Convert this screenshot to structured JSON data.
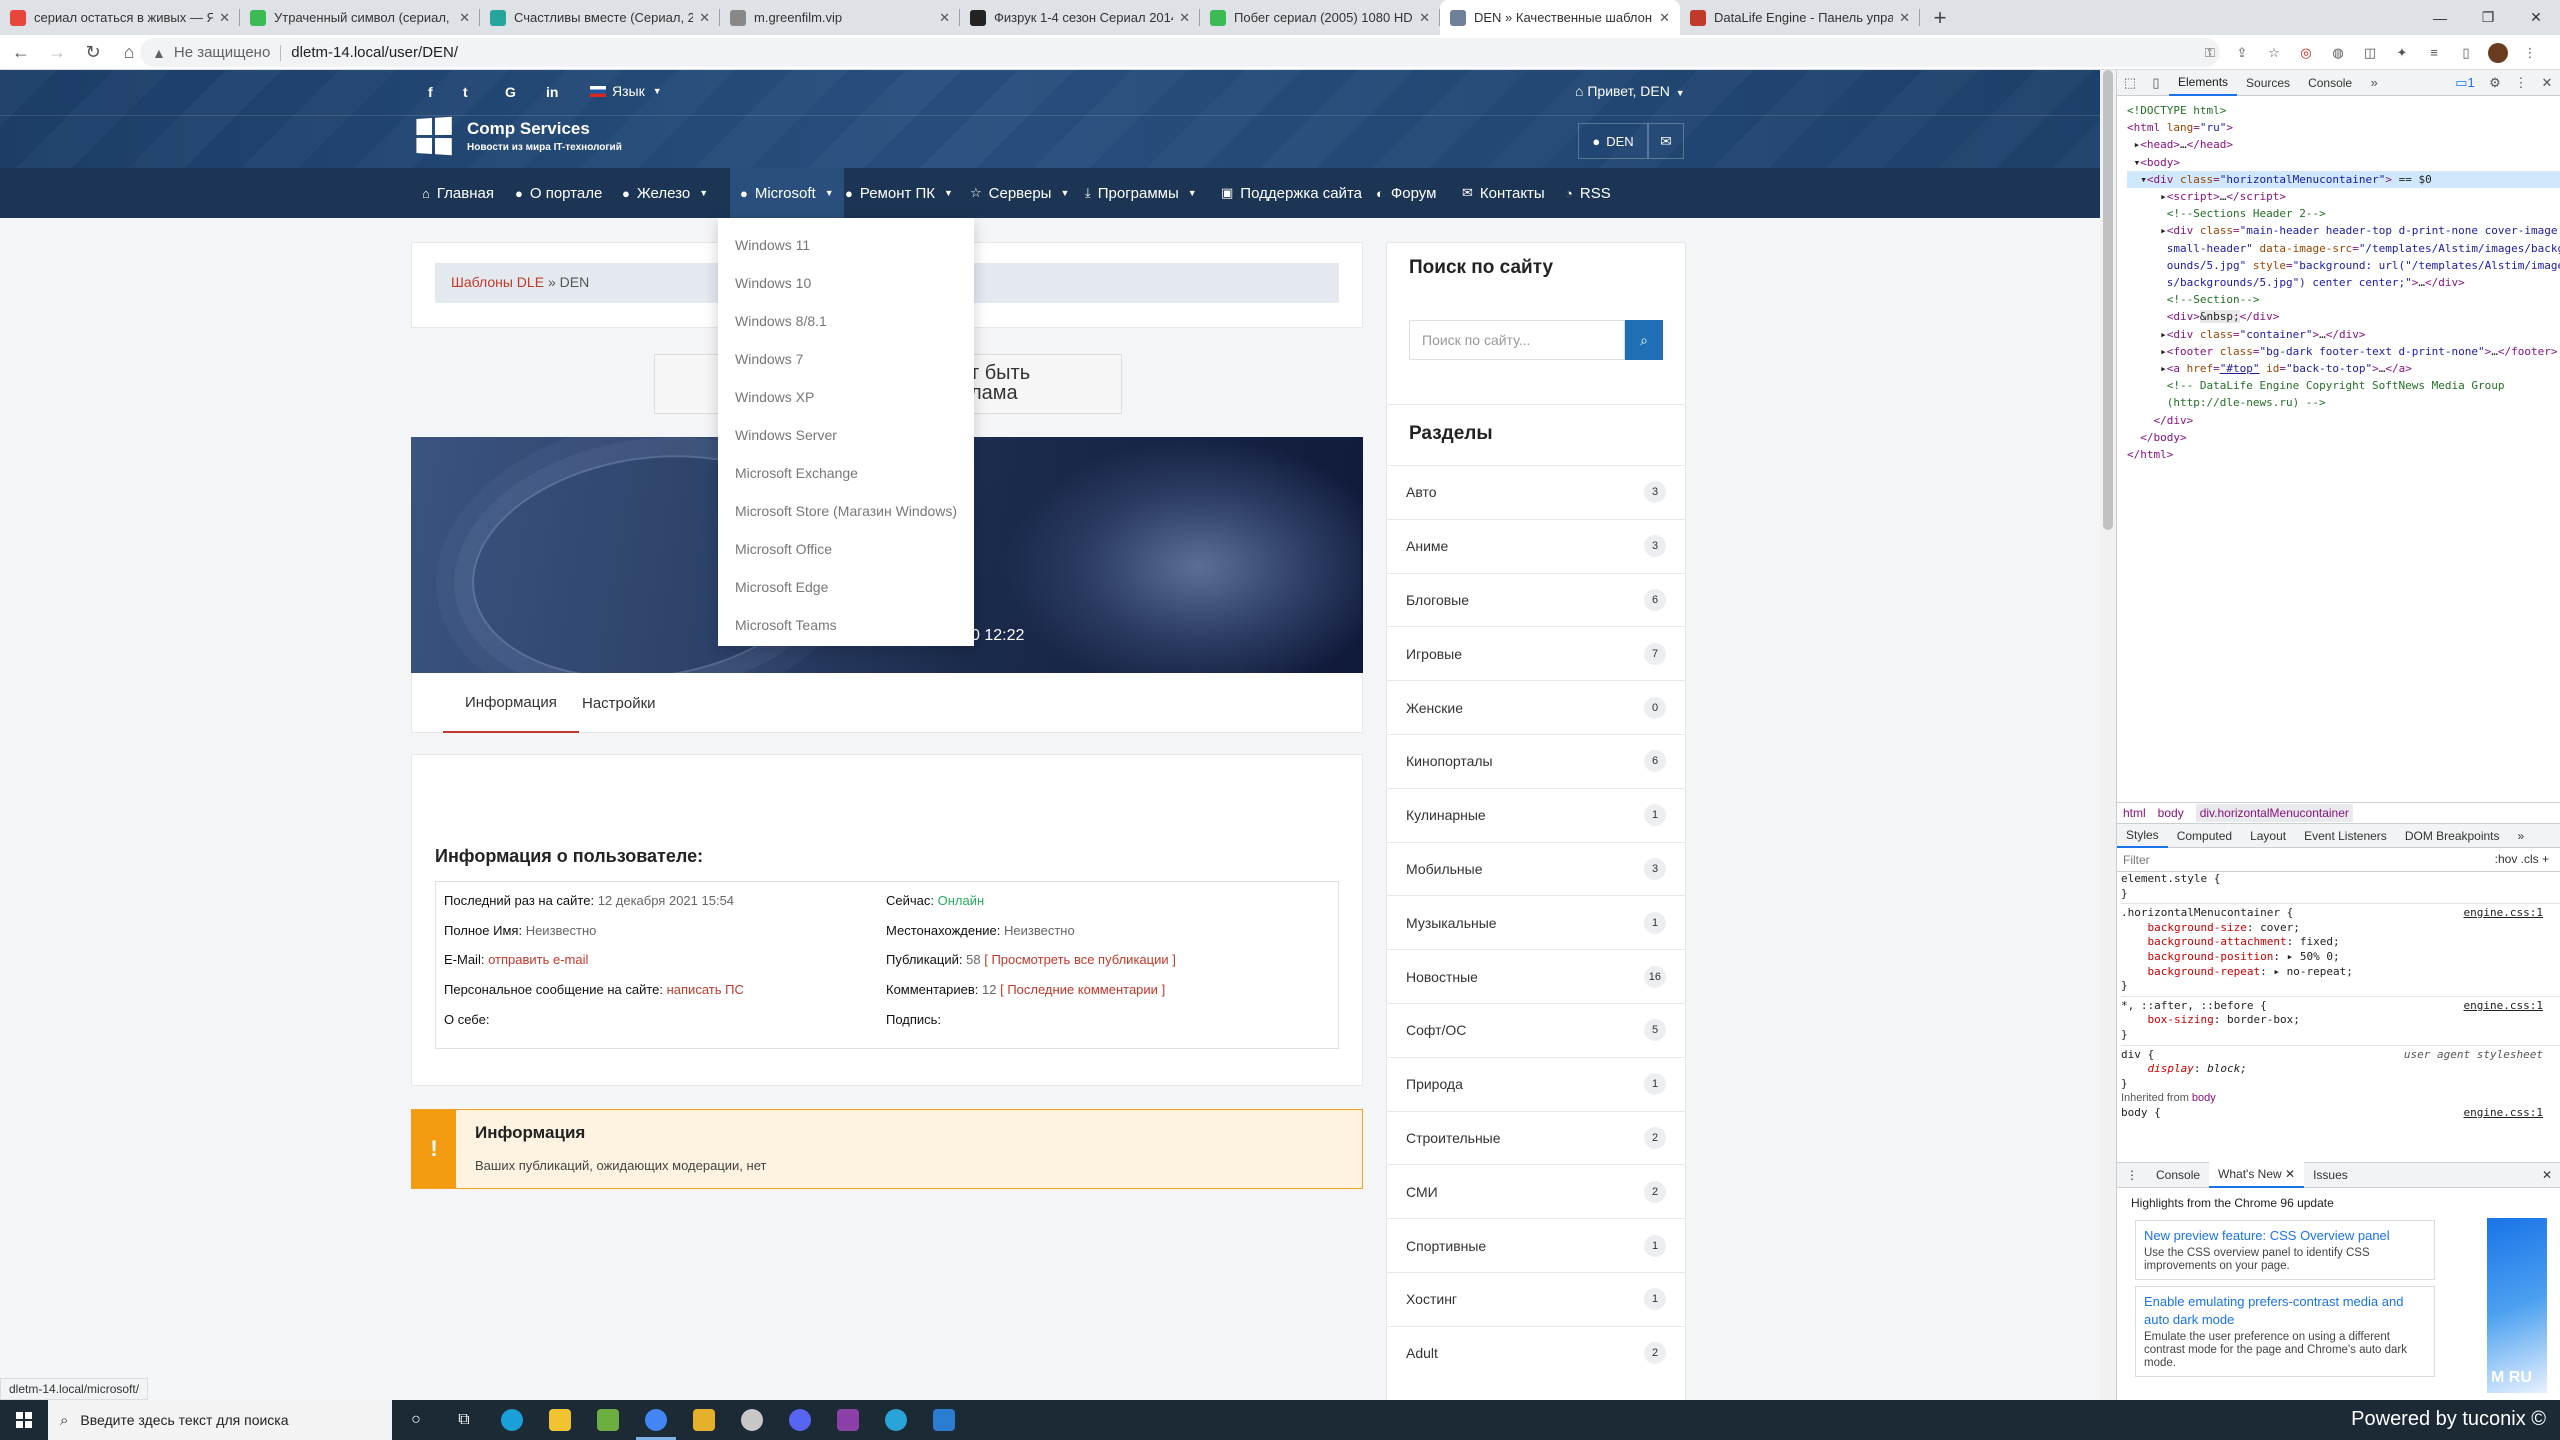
{
  "browser": {
    "tabs": [
      {
        "title": "сериал остаться в живых — Ян…",
        "icon": "yandex-icon",
        "color": "#e8453c"
      },
      {
        "title": "Утраченный символ (сериал, 1…",
        "icon": "hd-film-icon",
        "color": "#3cba54"
      },
      {
        "title": "Счастливы вместе (Сериал, 20…",
        "icon": "play-icon",
        "color": "#26a69a"
      },
      {
        "title": "m.greenfilm.vip",
        "icon": "globe-icon",
        "color": "#888888"
      },
      {
        "title": "Физрук 1-4 сезон Сериал 2014 -…",
        "icon": "hd-icon",
        "color": "#222222",
        "prefix": "HD"
      },
      {
        "title": "Побег сериал (2005) 1080 HD с…",
        "icon": "hd-film-icon",
        "color": "#3cba54"
      },
      {
        "title": "DEN » Качественные шаблоны…",
        "icon": "dle-icon",
        "color": "#6d7f99",
        "active": true
      },
      {
        "title": "DataLife Engine - Панель управ…",
        "icon": "dle-admin-icon",
        "color": "#c0392b"
      }
    ],
    "new_tab": "+",
    "insecure_label": "Не защищено",
    "url": "dletm-14.local/user/DEN/",
    "status_url": "dletm-14.local/microsoft/"
  },
  "site": {
    "social": [
      "f",
      "t",
      "G",
      "in"
    ],
    "lang_label": "Язык",
    "hello": "Привет, DEN",
    "logo_title": "Comp Services",
    "logo_sub": "Новости из мира IT-технологий",
    "user_label": "DEN",
    "nav": [
      {
        "label": "Главная",
        "icon": "home-icon",
        "glyph": "⌂"
      },
      {
        "label": "О портале",
        "icon": "info-icon",
        "glyph": "●"
      },
      {
        "label": "Железо",
        "icon": "globe-icon",
        "glyph": "●",
        "caret": true
      },
      {
        "label": "Microsoft",
        "icon": "info-icon",
        "glyph": "●",
        "caret": true,
        "active": true
      },
      {
        "label": "Ремонт ПК",
        "icon": "globe-icon",
        "glyph": "●",
        "caret": true
      },
      {
        "label": "Серверы",
        "icon": "star-icon",
        "glyph": "☆",
        "caret": true
      },
      {
        "label": "Программы",
        "icon": "download-icon",
        "glyph": "⤓",
        "caret": true
      },
      {
        "label": "Поддержка сайта",
        "icon": "card-icon",
        "glyph": "▣"
      },
      {
        "label": "Форум",
        "icon": "comments-icon",
        "glyph": "◐"
      },
      {
        "label": "Контакты",
        "icon": "mail-icon",
        "glyph": "✉"
      },
      {
        "label": "RSS",
        "icon": "rss-icon",
        "glyph": "◔"
      }
    ],
    "dropdown": [
      "Windows 11",
      "Windows 10",
      "Windows 8/8.1",
      "Windows 7",
      "Windows XP",
      "Windows Server",
      "Microsoft Exchange",
      "Microsoft Store (Магазин Windows)",
      "Microsoft Office",
      "Microsoft Edge",
      "Microsoft Teams"
    ],
    "breadcrumb": {
      "link": "Шаблоны DLE",
      "sep": "»",
      "current": "DEN"
    },
    "ad_text": "т быть\nлама",
    "banner_date": "0 12:22",
    "profile_tabs": [
      "Информация",
      "Настройки"
    ],
    "info": {
      "title": "Информация о пользователе:",
      "left": [
        {
          "label": "Последний раз на сайте:",
          "value": "12 декабря 2021 15:54"
        },
        {
          "label": "Полное Имя:",
          "value": "Неизвестно"
        },
        {
          "label": "E-Mail:",
          "link": "отправить e-mail"
        },
        {
          "label": "Персональное сообщение на сайте:",
          "link": "написать ПС"
        },
        {
          "label": "О себе:"
        }
      ],
      "right": [
        {
          "label": "Сейчас:",
          "green": "Онлайн"
        },
        {
          "label": "Местонахождение:",
          "value": "Неизвестно"
        },
        {
          "label": "Публикаций:",
          "value": "58",
          "link": "Просмотреть все публикации"
        },
        {
          "label": "Комментариев:",
          "value": "12",
          "link": "Последние комментарии"
        },
        {
          "label": "Подпись:"
        }
      ]
    },
    "alert": {
      "title": "Информация",
      "text": "Ваших публикаций, ожидающих модерации, нет"
    },
    "search": {
      "title": "Поиск по сайту",
      "placeholder": "Поиск по сайту..."
    },
    "categories_title": "Разделы",
    "categories": [
      {
        "name": "Авто",
        "count": "3"
      },
      {
        "name": "Аниме",
        "count": "3"
      },
      {
        "name": "Блоговые",
        "count": "6"
      },
      {
        "name": "Игровые",
        "count": "7"
      },
      {
        "name": "Женские",
        "count": "0"
      },
      {
        "name": "Кинопорталы",
        "count": "6"
      },
      {
        "name": "Кулинарные",
        "count": "1"
      },
      {
        "name": "Мобильные",
        "count": "3"
      },
      {
        "name": "Музыкальные",
        "count": "1"
      },
      {
        "name": "Новостные",
        "count": "16"
      },
      {
        "name": "Софт/ОС",
        "count": "5"
      },
      {
        "name": "Природа",
        "count": "1"
      },
      {
        "name": "Строительные",
        "count": "2"
      },
      {
        "name": "СМИ",
        "count": "2"
      },
      {
        "name": "Спортивные",
        "count": "1"
      },
      {
        "name": "Хостинг",
        "count": "1"
      },
      {
        "name": "Adult",
        "count": "2"
      }
    ]
  },
  "devtools": {
    "tabs": [
      "Elements",
      "Sources",
      "Console"
    ],
    "badge": "1",
    "breadcrumbs": [
      "html",
      "body",
      "div.horizontalMenucontainer"
    ],
    "style_tabs": [
      "Styles",
      "Computed",
      "Layout",
      "Event Listeners",
      "DOM Breakpoints"
    ],
    "filter_placeholder": "Filter",
    "filter_right": ":hov  .cls  +",
    "drawer_tabs": [
      "Console",
      "What's New",
      "Issues"
    ],
    "drawer_head": "Highlights from the Chrome 96 update",
    "whats_new": [
      {
        "title": "New preview feature: CSS Overview panel",
        "desc": "Use the CSS overview panel to identify CSS improvements on your page."
      },
      {
        "title": "Enable emulating prefers-contrast media and auto dark mode",
        "desc": "Emulate the user preference on using a different contrast mode for the page and Chrome's auto dark mode."
      }
    ],
    "wn_image_text": "M RU"
  },
  "taskbar": {
    "search_placeholder": "Введите здесь текст для поиска",
    "powered": "Powered by tuconix ©",
    "apps": [
      {
        "icon": "cortana-icon",
        "glyph": "○",
        "color": "transparent"
      },
      {
        "icon": "task-view-icon",
        "glyph": "⧉",
        "color": "transparent"
      },
      {
        "icon": "edge-icon",
        "glyph": "",
        "color": "#1aa0d8"
      },
      {
        "icon": "file-explorer-icon",
        "glyph": "",
        "color": "#f1c232"
      },
      {
        "icon": "notepad-icon",
        "glyph": "",
        "color": "#6cae3f"
      },
      {
        "icon": "chrome-icon",
        "glyph": "",
        "color": "#4285f4",
        "active": true
      },
      {
        "icon": "color-app-icon",
        "glyph": "",
        "color": "#e5b02a"
      },
      {
        "icon": "steam-icon",
        "glyph": "",
        "color": "#c7c7c7"
      },
      {
        "icon": "discord-icon",
        "glyph": "",
        "color": "#5865f2"
      },
      {
        "icon": "winrar-icon",
        "glyph": "",
        "color": "#8b3fa8"
      },
      {
        "icon": "telegram-icon",
        "glyph": "",
        "color": "#2aa3d8"
      },
      {
        "icon": "mail-icon",
        "glyph": "",
        "color": "#2b7cd3"
      }
    ]
  }
}
